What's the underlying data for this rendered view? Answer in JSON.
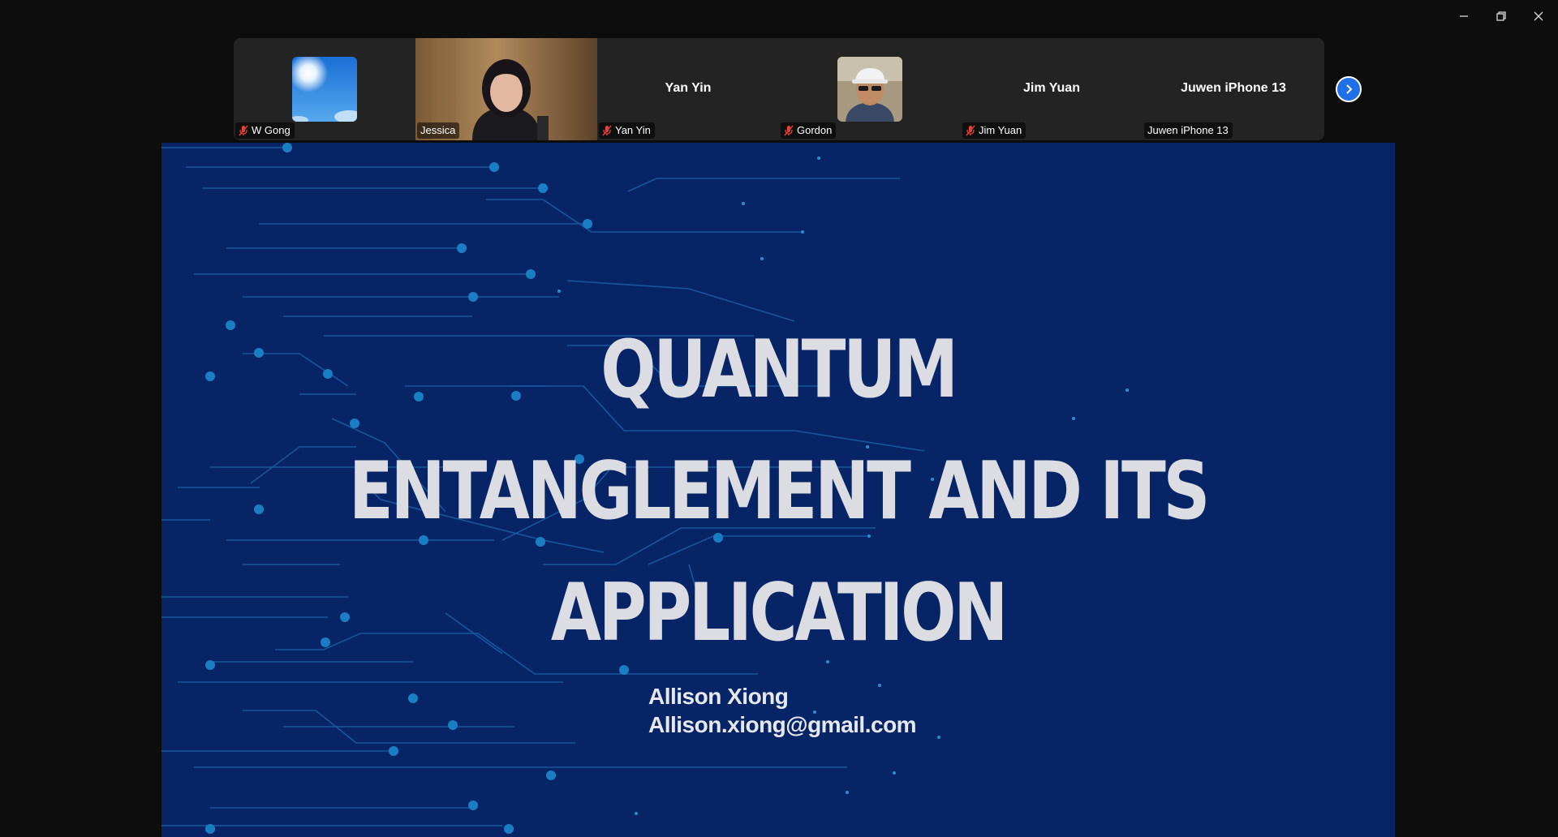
{
  "window": {
    "controls": [
      "minimize-icon",
      "restore-icon",
      "close-icon"
    ]
  },
  "participants": [
    {
      "tag": "W Gong",
      "muted": true,
      "display": "photo",
      "icon": "sky-photo"
    },
    {
      "tag": "Jessica",
      "muted": false,
      "display": "video",
      "active": true
    },
    {
      "tag": "Yan Yin",
      "muted": true,
      "display": "name",
      "name": "Yan Yin"
    },
    {
      "tag": "Gordon",
      "muted": true,
      "display": "photo",
      "icon": "portrait-photo"
    },
    {
      "tag": "Jim Yuan",
      "muted": true,
      "display": "name",
      "name": "Jim Yuan"
    },
    {
      "tag": "Juwen iPhone 13",
      "muted": false,
      "display": "name",
      "name": "Juwen iPhone 13"
    }
  ],
  "strip": {
    "next_icon": "chevron-right-icon"
  },
  "slide": {
    "title_lines": [
      "QUANTUM",
      "ENTANGLEMENT AND ITS",
      "APPLICATION"
    ],
    "author_name": "Allison Xiong",
    "author_email": "Allison.xiong@gmail.com",
    "colors": {
      "background": "#072566",
      "circuit": "#1d6fb3",
      "title": "#dcdde2"
    }
  }
}
